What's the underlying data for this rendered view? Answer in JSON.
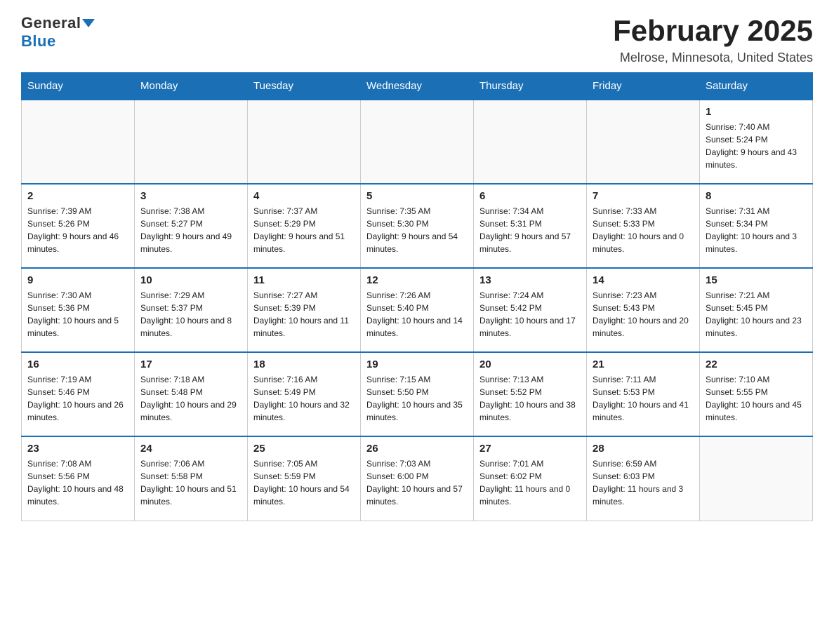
{
  "header": {
    "logo_general": "General",
    "logo_blue": "Blue",
    "month_title": "February 2025",
    "location": "Melrose, Minnesota, United States"
  },
  "days_of_week": [
    "Sunday",
    "Monday",
    "Tuesday",
    "Wednesday",
    "Thursday",
    "Friday",
    "Saturday"
  ],
  "weeks": [
    [
      {
        "day": "",
        "info": ""
      },
      {
        "day": "",
        "info": ""
      },
      {
        "day": "",
        "info": ""
      },
      {
        "day": "",
        "info": ""
      },
      {
        "day": "",
        "info": ""
      },
      {
        "day": "",
        "info": ""
      },
      {
        "day": "1",
        "info": "Sunrise: 7:40 AM\nSunset: 5:24 PM\nDaylight: 9 hours and 43 minutes."
      }
    ],
    [
      {
        "day": "2",
        "info": "Sunrise: 7:39 AM\nSunset: 5:26 PM\nDaylight: 9 hours and 46 minutes."
      },
      {
        "day": "3",
        "info": "Sunrise: 7:38 AM\nSunset: 5:27 PM\nDaylight: 9 hours and 49 minutes."
      },
      {
        "day": "4",
        "info": "Sunrise: 7:37 AM\nSunset: 5:29 PM\nDaylight: 9 hours and 51 minutes."
      },
      {
        "day": "5",
        "info": "Sunrise: 7:35 AM\nSunset: 5:30 PM\nDaylight: 9 hours and 54 minutes."
      },
      {
        "day": "6",
        "info": "Sunrise: 7:34 AM\nSunset: 5:31 PM\nDaylight: 9 hours and 57 minutes."
      },
      {
        "day": "7",
        "info": "Sunrise: 7:33 AM\nSunset: 5:33 PM\nDaylight: 10 hours and 0 minutes."
      },
      {
        "day": "8",
        "info": "Sunrise: 7:31 AM\nSunset: 5:34 PM\nDaylight: 10 hours and 3 minutes."
      }
    ],
    [
      {
        "day": "9",
        "info": "Sunrise: 7:30 AM\nSunset: 5:36 PM\nDaylight: 10 hours and 5 minutes."
      },
      {
        "day": "10",
        "info": "Sunrise: 7:29 AM\nSunset: 5:37 PM\nDaylight: 10 hours and 8 minutes."
      },
      {
        "day": "11",
        "info": "Sunrise: 7:27 AM\nSunset: 5:39 PM\nDaylight: 10 hours and 11 minutes."
      },
      {
        "day": "12",
        "info": "Sunrise: 7:26 AM\nSunset: 5:40 PM\nDaylight: 10 hours and 14 minutes."
      },
      {
        "day": "13",
        "info": "Sunrise: 7:24 AM\nSunset: 5:42 PM\nDaylight: 10 hours and 17 minutes."
      },
      {
        "day": "14",
        "info": "Sunrise: 7:23 AM\nSunset: 5:43 PM\nDaylight: 10 hours and 20 minutes."
      },
      {
        "day": "15",
        "info": "Sunrise: 7:21 AM\nSunset: 5:45 PM\nDaylight: 10 hours and 23 minutes."
      }
    ],
    [
      {
        "day": "16",
        "info": "Sunrise: 7:19 AM\nSunset: 5:46 PM\nDaylight: 10 hours and 26 minutes."
      },
      {
        "day": "17",
        "info": "Sunrise: 7:18 AM\nSunset: 5:48 PM\nDaylight: 10 hours and 29 minutes."
      },
      {
        "day": "18",
        "info": "Sunrise: 7:16 AM\nSunset: 5:49 PM\nDaylight: 10 hours and 32 minutes."
      },
      {
        "day": "19",
        "info": "Sunrise: 7:15 AM\nSunset: 5:50 PM\nDaylight: 10 hours and 35 minutes."
      },
      {
        "day": "20",
        "info": "Sunrise: 7:13 AM\nSunset: 5:52 PM\nDaylight: 10 hours and 38 minutes."
      },
      {
        "day": "21",
        "info": "Sunrise: 7:11 AM\nSunset: 5:53 PM\nDaylight: 10 hours and 41 minutes."
      },
      {
        "day": "22",
        "info": "Sunrise: 7:10 AM\nSunset: 5:55 PM\nDaylight: 10 hours and 45 minutes."
      }
    ],
    [
      {
        "day": "23",
        "info": "Sunrise: 7:08 AM\nSunset: 5:56 PM\nDaylight: 10 hours and 48 minutes."
      },
      {
        "day": "24",
        "info": "Sunrise: 7:06 AM\nSunset: 5:58 PM\nDaylight: 10 hours and 51 minutes."
      },
      {
        "day": "25",
        "info": "Sunrise: 7:05 AM\nSunset: 5:59 PM\nDaylight: 10 hours and 54 minutes."
      },
      {
        "day": "26",
        "info": "Sunrise: 7:03 AM\nSunset: 6:00 PM\nDaylight: 10 hours and 57 minutes."
      },
      {
        "day": "27",
        "info": "Sunrise: 7:01 AM\nSunset: 6:02 PM\nDaylight: 11 hours and 0 minutes."
      },
      {
        "day": "28",
        "info": "Sunrise: 6:59 AM\nSunset: 6:03 PM\nDaylight: 11 hours and 3 minutes."
      },
      {
        "day": "",
        "info": ""
      }
    ]
  ]
}
